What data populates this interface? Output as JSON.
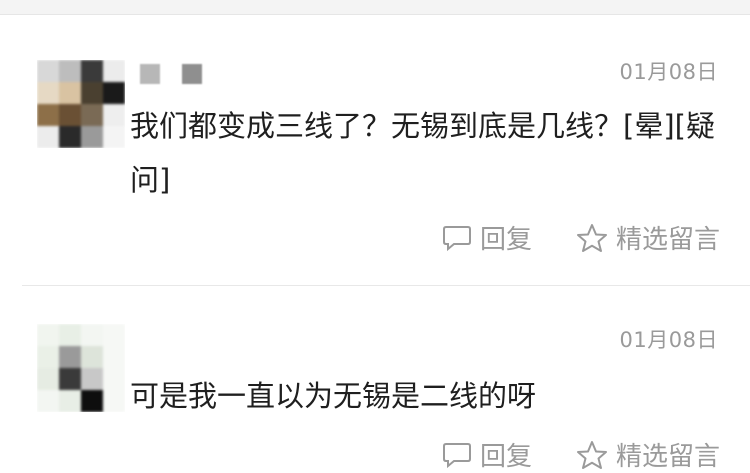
{
  "comments": [
    {
      "date": "01月08日",
      "text": "我们都变成三线了？无锡到底是几线？[晕][疑问]",
      "actions": {
        "reply_label": "回复",
        "featured_label": "精选留言"
      },
      "colors": {
        "avatar": [
          "#d8d8d8",
          "#bdbdbd",
          "#3a3a3a",
          "#ececec",
          "#e6d9c4",
          "#d9c3a2",
          "#4a4030",
          "#1a1a1a",
          "#8d6f48",
          "#6a5034",
          "#7a6a55",
          "#eeeeee",
          "#ececec",
          "#2a2a2a",
          "#9a9a9a",
          "#f4f4f4"
        ],
        "name_blocks": [
          "#b7b7b7",
          "#8f8f8f"
        ]
      }
    },
    {
      "date": "01月08日",
      "text": "可是我一直以为无锡是二线的呀",
      "actions": {
        "reply_label": "回复",
        "featured_label": "精选留言"
      },
      "colors": {
        "avatar": [
          "#f1f5ef",
          "#e8efe6",
          "#f3f6f2",
          "#f6f8f5",
          "#eaf0e7",
          "#9a9a9a",
          "#dde4da",
          "#f6f8f5",
          "#e6ece3",
          "#3a3a3a",
          "#c8c8c8",
          "#f6f8f5",
          "#f3f6f2",
          "#e8eee6",
          "#0e0e0e",
          "#f6f8f5"
        ]
      }
    }
  ],
  "colors": {
    "text": "#1f1f1f",
    "muted": "#9a9a9a",
    "divider": "#e8e8e8"
  }
}
